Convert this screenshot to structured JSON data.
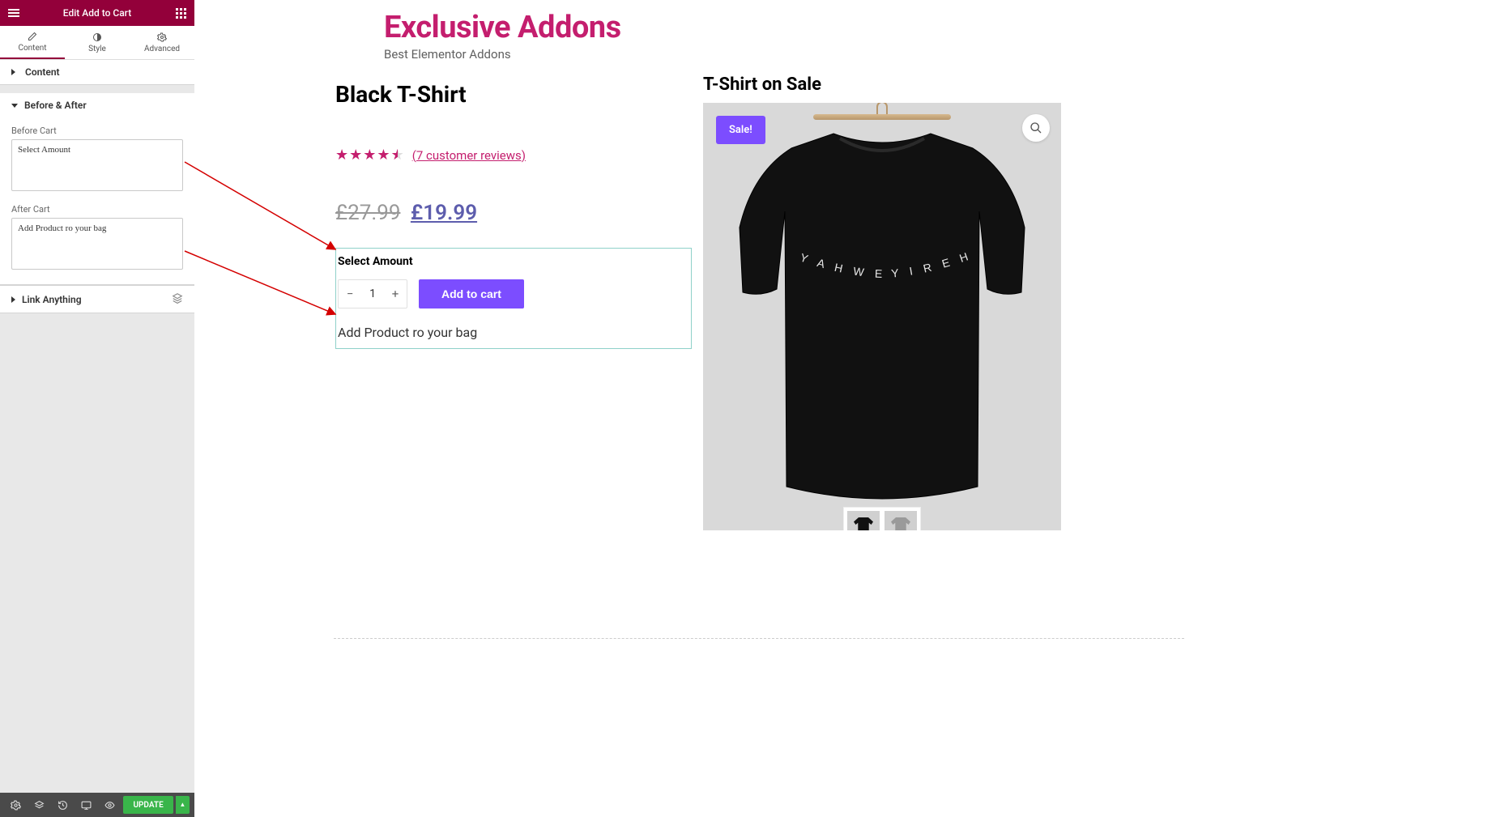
{
  "sidebar": {
    "header_title": "Edit Add to Cart",
    "tabs": {
      "content": "Content",
      "style": "Style",
      "advanced": "Advanced"
    },
    "sections": {
      "content": "Content",
      "before_after": "Before & After",
      "link_anything": "Link Anything"
    },
    "fields": {
      "before_cart_label": "Before Cart",
      "before_cart_value": "Select Amount",
      "after_cart_label": "After Cart",
      "after_cart_value": "Add Product ro your bag"
    },
    "footer": {
      "update": "UPDATE"
    }
  },
  "brand": {
    "title": "Exclusive Addons",
    "subtitle": "Best Elementor Addons"
  },
  "product": {
    "title": "Black T-Shirt",
    "reviews_link": "(7 customer reviews)",
    "price_old": "£27.99",
    "price_new": "£19.99",
    "before_cart": "Select Amount",
    "qty": "1",
    "add_to_cart": "Add to cart",
    "after_cart": "Add Product ro your bag"
  },
  "rightcol": {
    "title": "T-Shirt on Sale",
    "sale_badge": "Sale!",
    "shirt_text_left": "Y A H W E H",
    "shirt_text_right": "Y I R E H"
  }
}
